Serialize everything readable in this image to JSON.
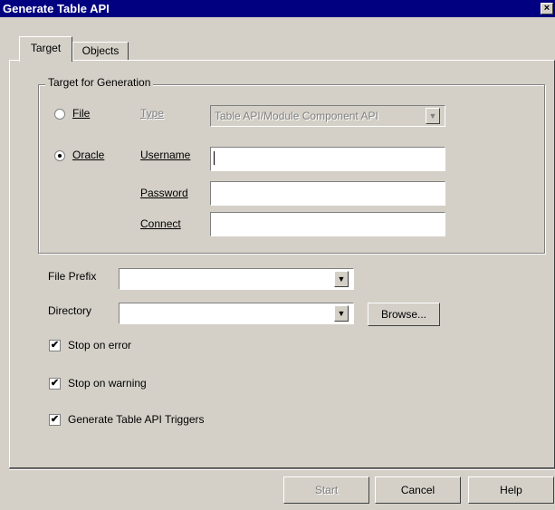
{
  "window": {
    "title": "Generate Table API",
    "close_glyph": "×"
  },
  "tabs": [
    {
      "label": "Target",
      "active": true
    },
    {
      "label": "Objects",
      "active": false
    }
  ],
  "target_group": {
    "legend": "Target for Generation",
    "file_option": {
      "label": "File",
      "selected": false
    },
    "oracle_option": {
      "label": "Oracle",
      "selected": true
    },
    "type_label": "Type",
    "type_value": "Table API/Module Component API",
    "username_label": "Username",
    "username_value": "",
    "password_label": "Password",
    "password_value": "",
    "connect_label": "Connect",
    "connect_value": ""
  },
  "file_prefix": {
    "label": "File Prefix",
    "value": ""
  },
  "directory": {
    "label": "Directory",
    "value": "",
    "browse_label": "Browse..."
  },
  "options": [
    {
      "label": "Stop on error",
      "checked": true
    },
    {
      "label": "Stop on warning",
      "checked": true
    },
    {
      "label": "Generate Table API Triggers",
      "checked": true
    }
  ],
  "buttons": {
    "start": "Start",
    "cancel": "Cancel",
    "help": "Help"
  },
  "icons": {
    "check": "✔",
    "dropdown": "▼"
  }
}
